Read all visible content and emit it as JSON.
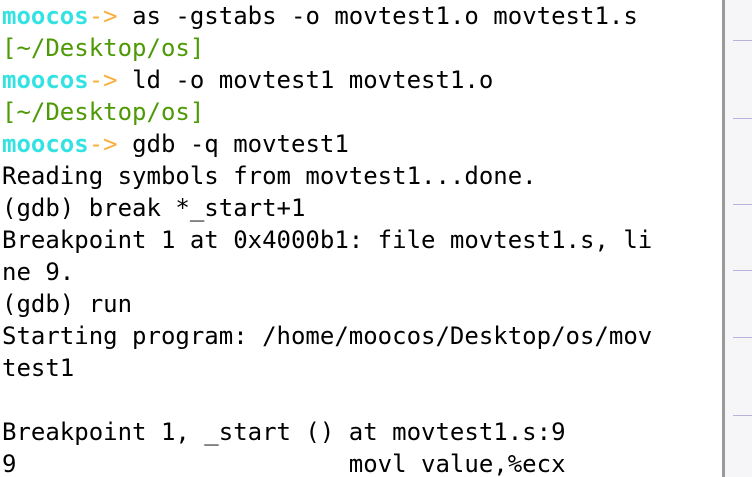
{
  "terminal": {
    "prompt": {
      "name": "moocos",
      "arrow": "->"
    },
    "lines": [
      {
        "kind": "command",
        "text": "as -gstabs -o movtest1.o movtest1.s"
      },
      {
        "kind": "cwd",
        "text": "[~/Desktop/os]"
      },
      {
        "kind": "command",
        "text": "ld -o movtest1 movtest1.o"
      },
      {
        "kind": "cwd",
        "text": "[~/Desktop/os]"
      },
      {
        "kind": "command",
        "text": "gdb -q movtest1"
      },
      {
        "kind": "output",
        "text": "Reading symbols from movtest1...done."
      },
      {
        "kind": "output",
        "text": "(gdb) break *_start+1"
      },
      {
        "kind": "output",
        "text": "Breakpoint 1 at 0x4000b1: file movtest1.s, li"
      },
      {
        "kind": "output",
        "text": "ne 9."
      },
      {
        "kind": "output",
        "text": "(gdb) run"
      },
      {
        "kind": "output",
        "text": "Starting program: /home/moocos/Desktop/os/mov"
      },
      {
        "kind": "output",
        "text": "test1"
      },
      {
        "kind": "output",
        "text": ""
      },
      {
        "kind": "output",
        "text": "Breakpoint 1, _start () at movtest1.s:9"
      },
      {
        "kind": "output",
        "text": "9                       movl value,%ecx"
      }
    ]
  },
  "colors": {
    "prompt_name": "#34e2e2",
    "prompt_arrow": "#fcaf3e",
    "cwd": "#4e9a06",
    "text": "#000000",
    "background": "#ffffff"
  }
}
